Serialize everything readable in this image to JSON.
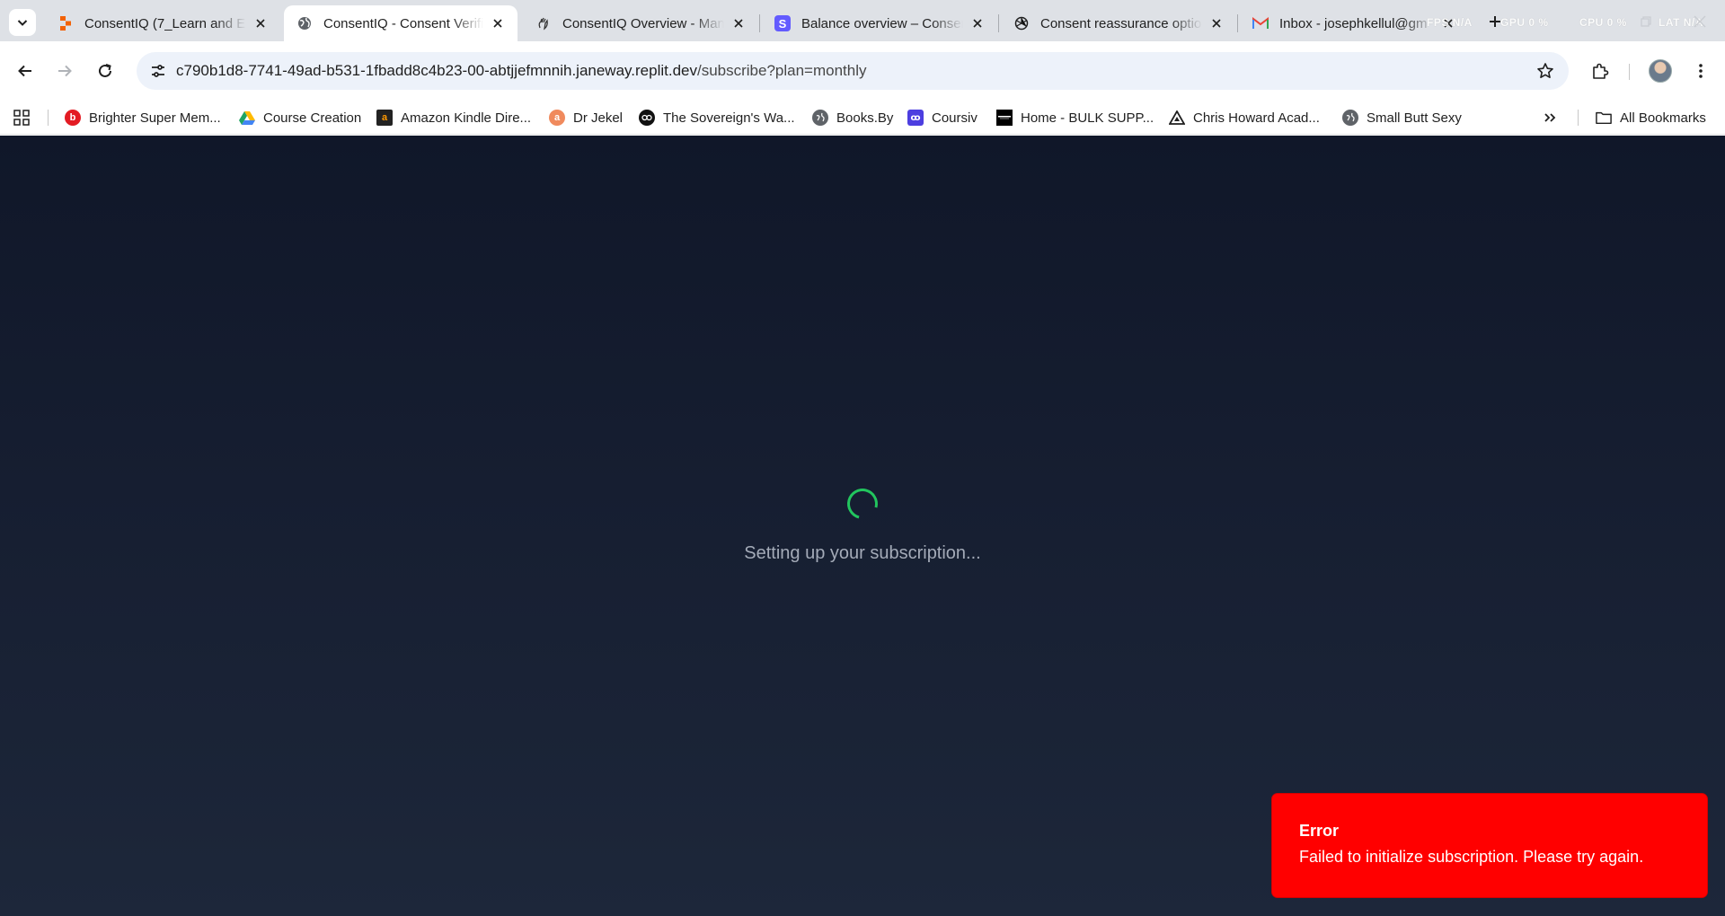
{
  "tabs": [
    {
      "title": "ConsentIQ (7_Learn and En",
      "active": false,
      "favicon": "replit-icon"
    },
    {
      "title": "ConsentIQ - Consent Verific",
      "active": true,
      "favicon": "globe-icon"
    },
    {
      "title": "ConsentIQ Overview - Man",
      "active": false,
      "favicon": "manus-icon"
    },
    {
      "title": "Balance overview – Consen",
      "active": false,
      "favicon": "stripe-icon"
    },
    {
      "title": "Consent reassurance optio",
      "active": false,
      "favicon": "openai-icon"
    },
    {
      "title": "Inbox - josephkellul@gm",
      "active": false,
      "favicon": "gmail-icon"
    }
  ],
  "perf_overlay": {
    "fps": "FPS N/A",
    "gpu": "GPU  0 %",
    "cpu": "CPU  0 %",
    "lat": "LAT  N/A"
  },
  "address_bar": {
    "host": "c790b1d8-7741-49ad-b531-1fbadd8c4b23-00-abtjjefmnnih.janeway.replit.dev",
    "path": "/subscribe?plan=monthly"
  },
  "bookmarks": [
    {
      "label": "Brighter Super Mem...",
      "icon": "brighter-icon",
      "color": "#e31b23"
    },
    {
      "label": "Course Creation",
      "icon": "google-drive-icon",
      "color": "#1fa463"
    },
    {
      "label": "Amazon Kindle Dire...",
      "icon": "amazon-icon",
      "color": "#222222"
    },
    {
      "label": "Dr Jekel",
      "icon": "dr-jekel-icon",
      "color": "#f08a5d"
    },
    {
      "label": "The Sovereign's Wa...",
      "icon": "sovereign-icon",
      "color": "#111111"
    },
    {
      "label": "Books.By",
      "icon": "globe-icon",
      "color": "#5f6368"
    },
    {
      "label": "Coursiv",
      "icon": "coursiv-icon",
      "color": "#4c3ee0"
    },
    {
      "label": "Home - BULK SUPP...",
      "icon": "bulk-icon",
      "color": "#000000"
    },
    {
      "label": "Chris Howard Acad...",
      "icon": "triangle-icon",
      "color": "#1f1f1f"
    },
    {
      "label": "Small Butt Sexy",
      "icon": "globe-icon",
      "color": "#5f6368"
    }
  ],
  "all_bookmarks_label": "All Bookmarks",
  "page": {
    "loading_text": "Setting up your subscription...",
    "accent_color": "#22c55e"
  },
  "toast": {
    "title": "Error",
    "message": "Failed to initialize subscription. Please try again.",
    "color": "#ff0000"
  }
}
